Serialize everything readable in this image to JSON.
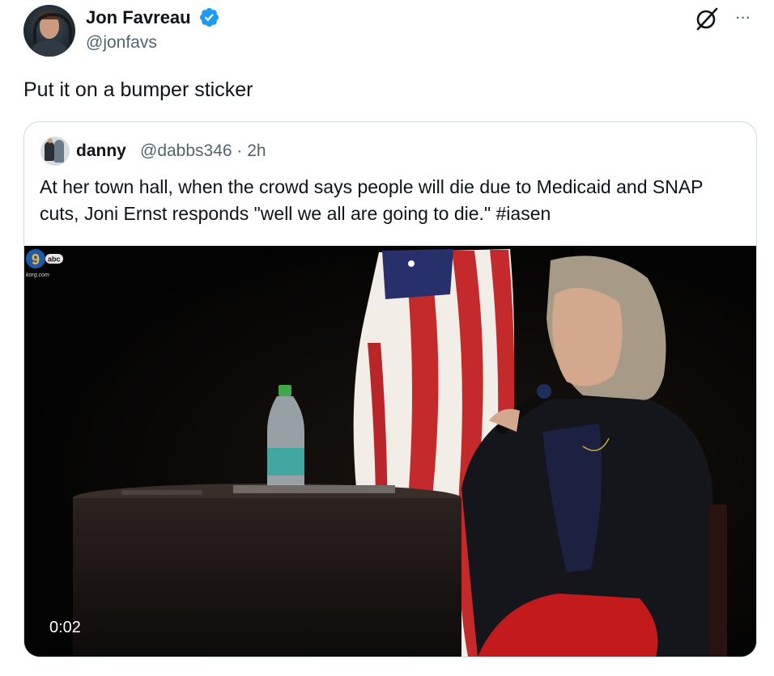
{
  "author": {
    "display_name": "Jon Favreau",
    "handle": "@jonfavs",
    "verified": true,
    "avatar_icon": "profile-avatar"
  },
  "tweet": {
    "text": "Put it on a bumper sticker"
  },
  "actions": {
    "grok_icon": "grok-icon",
    "more_label": "···"
  },
  "quoted_tweet": {
    "display_name": "danny",
    "handle": "@dabbs346",
    "separator": "·",
    "time": "2h",
    "handle_line": "@dabbs346 · 2h",
    "text": "At her town hall, when the crowd says people will die due to Medicaid and SNAP cuts, Joni Ernst responds \"well we all are going to die.\" #iasen",
    "media": {
      "type": "video",
      "timestamp": "0:02",
      "watermark_text": "abc",
      "watermark_subtext": "korg.com"
    }
  },
  "colors": {
    "text_primary": "#0f1419",
    "text_secondary": "#536471",
    "verified_blue": "#1d9bf0",
    "border": "#cfd9de"
  }
}
